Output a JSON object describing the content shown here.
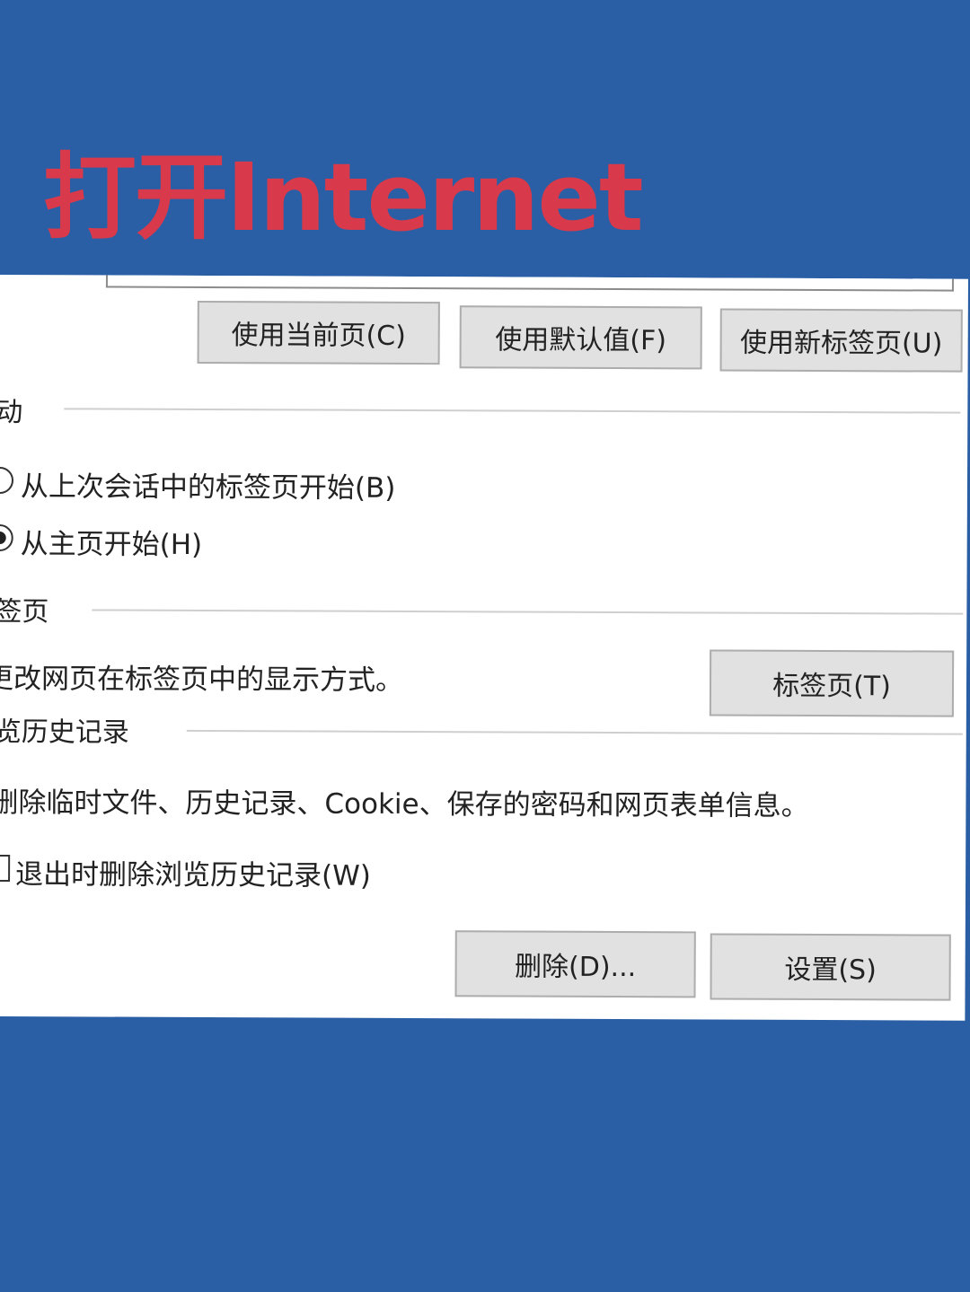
{
  "headline": "打开Internet",
  "colors": {
    "background": "#2a5fa5",
    "headline": "#d83a4b",
    "panel": "#ffffff",
    "button_face": "#e1e1e1"
  },
  "home_page": {
    "buttons": {
      "use_current": "使用当前页(C)",
      "use_default": "使用默认值(F)",
      "use_new_tab": "使用新标签页(U)"
    }
  },
  "startup": {
    "label": "动",
    "options": [
      {
        "label": "从上次会话中的标签页开始(B)",
        "checked": false
      },
      {
        "label": "从主页开始(H)",
        "checked": true
      }
    ]
  },
  "tabs": {
    "label": "签页",
    "description": "更改网页在标签页中的显示方式。",
    "button": "标签页(T)"
  },
  "history": {
    "label": "览历史记录",
    "description": "删除临时文件、历史记录、Cookie、保存的密码和网页表单信息。",
    "checkbox_label": "退出时删除浏览历史记录(W)",
    "checkbox_checked": false,
    "delete_button": "删除(D)...",
    "settings_button": "设置(S)"
  }
}
